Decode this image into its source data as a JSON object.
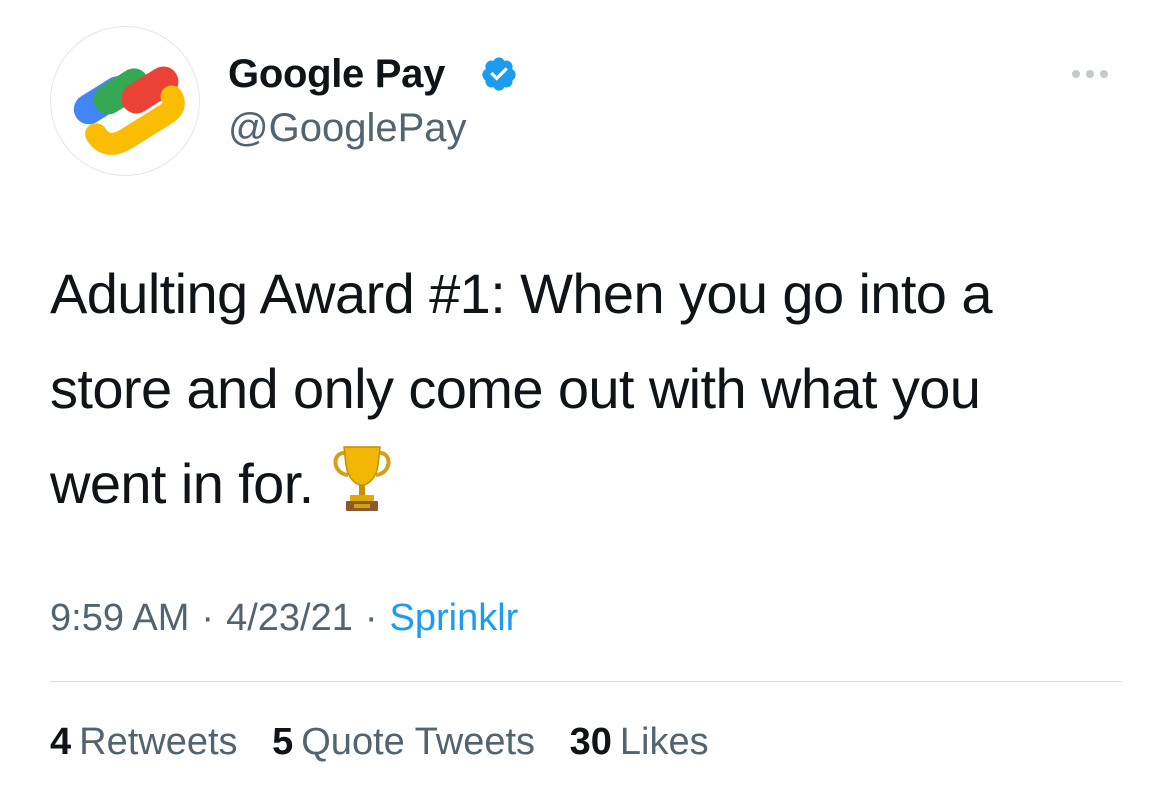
{
  "author": {
    "display_name": "Google Pay",
    "handle": "@GooglePay",
    "avatar_icon": "google-pay-logo-icon",
    "verified_icon": "verified-badge-icon",
    "verified_color": "#1d9bf0"
  },
  "tweet": {
    "lines": [
      "Adulting Award #1: When you go into a",
      "store and only come out with what you",
      "went in for."
    ],
    "emoji_icon": "trophy-icon"
  },
  "meta": {
    "time": "9:59 AM",
    "separator": "·",
    "date": "4/23/21",
    "source": "Sprinklr"
  },
  "stats": {
    "retweets_count": "4",
    "retweets_label": "Retweets",
    "quotes_count": "5",
    "quotes_label": "Quote Tweets",
    "likes_count": "30",
    "likes_label": "Likes"
  },
  "colors": {
    "text": "#0f1419",
    "secondary": "#536471",
    "link": "#1d9bf0",
    "divider": "#dcdfe2"
  }
}
